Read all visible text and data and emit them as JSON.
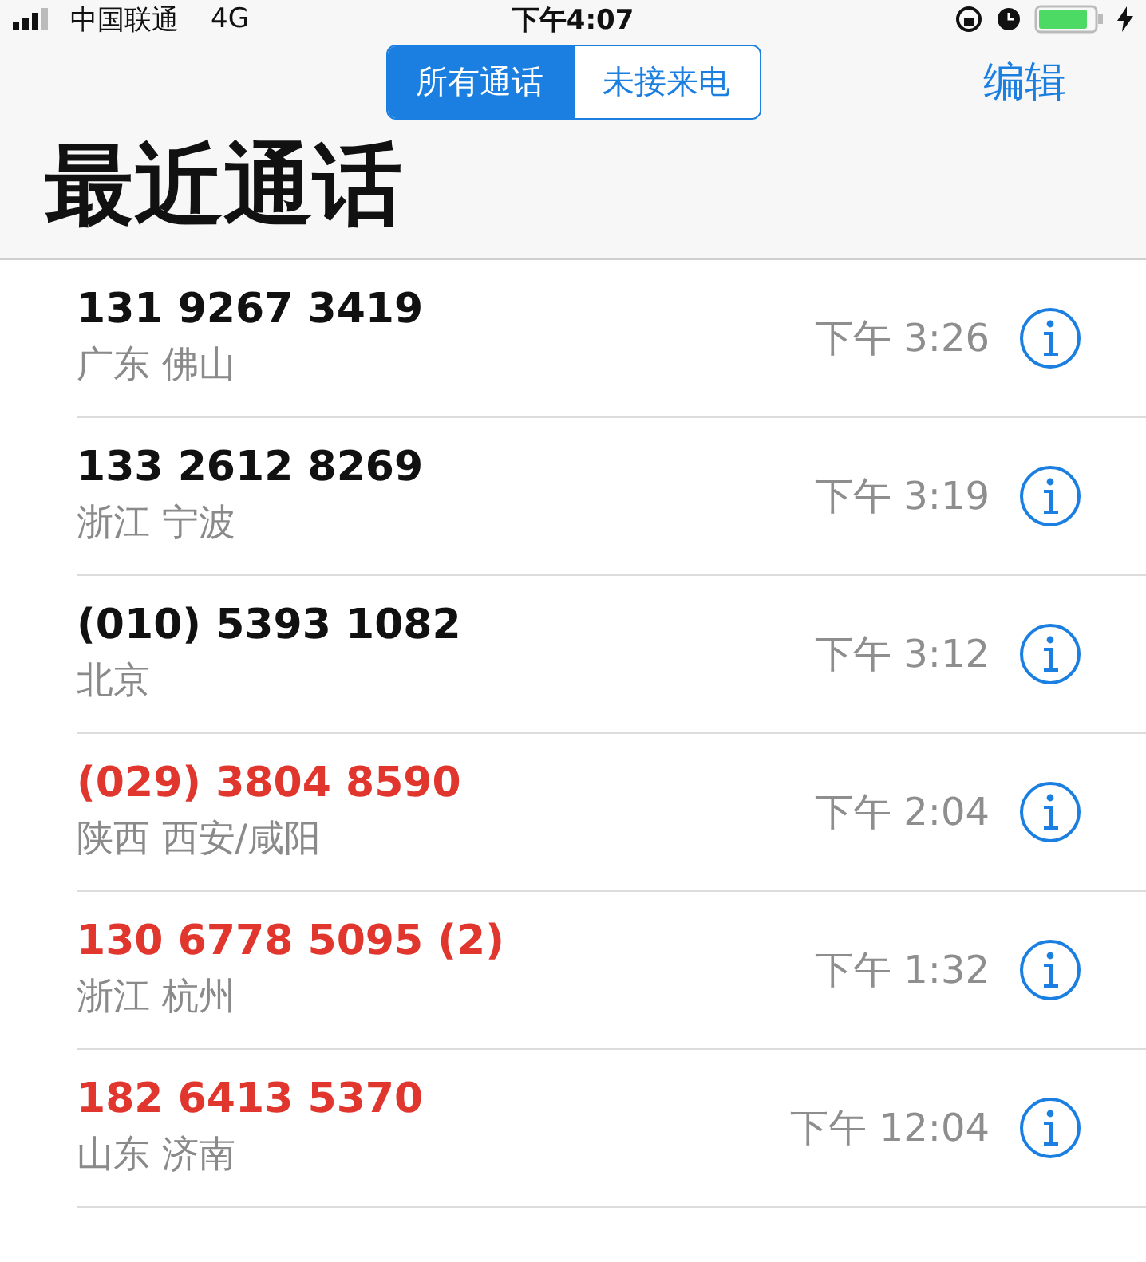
{
  "status_bar": {
    "carrier": "中国联通",
    "network": "4G",
    "time": "下午4:07"
  },
  "segments": [
    {
      "label": "所有通话",
      "selected": true
    },
    {
      "label": "未接来电",
      "selected": false
    }
  ],
  "edit_button": "编辑",
  "title": "最近通话",
  "calls": [
    {
      "number": "131 9267 3419",
      "location": "广东 佛山",
      "time": "下午 3:26",
      "missed": false
    },
    {
      "number": "133 2612 8269",
      "location": "浙江 宁波",
      "time": "下午 3:19",
      "missed": false
    },
    {
      "number": "(010) 5393 1082",
      "location": "北京",
      "time": "下午 3:12",
      "missed": false
    },
    {
      "number": "(029) 3804 8590",
      "location": "陕西 西安/咸阳",
      "time": "下午 2:04",
      "missed": true
    },
    {
      "number": "130 6778 5095 (2)",
      "location": "浙江 杭州",
      "time": "下午 1:32",
      "missed": true
    },
    {
      "number": "182 6413 5370",
      "location": "山东 济南",
      "time": "下午 12:04",
      "missed": true
    }
  ]
}
